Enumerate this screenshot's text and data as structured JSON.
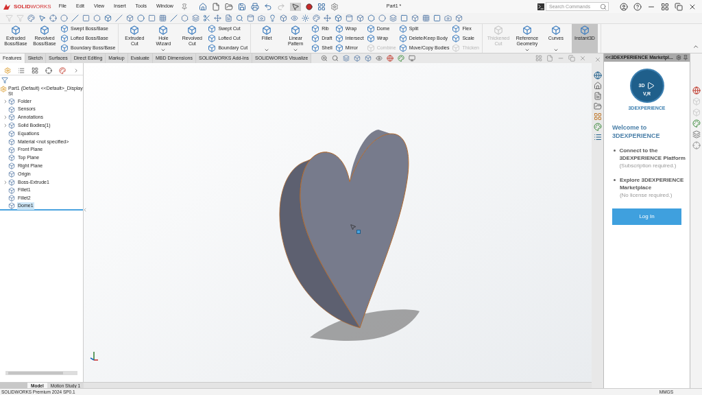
{
  "app": {
    "logo": "**SOLID**WORKS",
    "menu": [
      "File",
      "Edit",
      "View",
      "Insert",
      "Tools",
      "Window"
    ],
    "title": "Part1 *",
    "search": {
      "placeholder": "Search Commands"
    }
  },
  "ribbon": {
    "groups": [
      {
        "columns": [
          {
            "kind": "large",
            "label": "Extruded Boss/Base",
            "disabled": false,
            "dropdown": false
          },
          {
            "kind": "large",
            "label": "Revolved Boss/Base",
            "disabled": false,
            "dropdown": false
          },
          {
            "kind": "stack",
            "items": [
              {
                "label": "Swept Boss/Base",
                "disabled": false
              },
              {
                "label": "Lofted Boss/Base",
                "disabled": false
              },
              {
                "label": "Boundary Boss/Base",
                "disabled": false
              }
            ]
          }
        ]
      },
      {
        "columns": [
          {
            "kind": "large",
            "label": "Extruded Cut",
            "disabled": false,
            "dropdown": false
          },
          {
            "kind": "large",
            "label": "Hole Wizard",
            "disabled": false,
            "dropdown": true
          },
          {
            "kind": "large",
            "label": "Revolved Cut",
            "disabled": false,
            "dropdown": false
          },
          {
            "kind": "stack",
            "items": [
              {
                "label": "Swept Cut",
                "disabled": false
              },
              {
                "label": "Lofted Cut",
                "disabled": false
              },
              {
                "label": "Boundary Cut",
                "disabled": false
              }
            ]
          }
        ]
      },
      {
        "columns": [
          {
            "kind": "large",
            "label": "Fillet",
            "disabled": false,
            "dropdown": true
          },
          {
            "kind": "large",
            "label": "Linear Pattern",
            "disabled": false,
            "dropdown": true
          },
          {
            "kind": "stack",
            "items": [
              {
                "label": "Rib",
                "disabled": false
              },
              {
                "label": "Draft",
                "disabled": false
              },
              {
                "label": "Shell",
                "disabled": false
              }
            ]
          },
          {
            "kind": "stack",
            "items": [
              {
                "label": "Wrap",
                "disabled": false
              },
              {
                "label": "Intersect",
                "disabled": false
              },
              {
                "label": "Mirror",
                "disabled": false
              }
            ]
          },
          {
            "kind": "stack",
            "items": [
              {
                "label": "Dome",
                "disabled": false
              },
              {
                "label": "Wrap",
                "disabled": false
              },
              {
                "label": "Combine",
                "disabled": true
              }
            ]
          },
          {
            "kind": "stack",
            "items": [
              {
                "label": "Split",
                "disabled": false
              },
              {
                "label": "Delete/Keep Body",
                "disabled": false
              },
              {
                "label": "Move/Copy Bodies",
                "disabled": false
              }
            ]
          },
          {
            "kind": "stack",
            "items": [
              {
                "label": "Flex",
                "disabled": false
              },
              {
                "label": "Scale",
                "disabled": false
              },
              {
                "label": "Thicken",
                "disabled": true
              }
            ]
          }
        ]
      },
      {
        "columns": [
          {
            "kind": "large",
            "label": "Thickened Cut",
            "disabled": true,
            "dropdown": false
          },
          {
            "kind": "large",
            "label": "Reference Geometry",
            "disabled": false,
            "dropdown": true
          },
          {
            "kind": "large",
            "label": "Curves",
            "disabled": false,
            "dropdown": true
          },
          {
            "kind": "large",
            "label": "Instant3D",
            "disabled": false,
            "dropdown": false,
            "selected": true
          }
        ]
      }
    ]
  },
  "tabs": [
    {
      "label": "Features",
      "selected": true
    },
    {
      "label": "Sketch",
      "selected": false
    },
    {
      "label": "Surfaces",
      "selected": false
    },
    {
      "label": "Direct Editing",
      "selected": false
    },
    {
      "label": "Markup",
      "selected": false
    },
    {
      "label": "Evaluate",
      "selected": false
    },
    {
      "label": "MBD Dimensions",
      "selected": false
    },
    {
      "label": "SOLIDWORKS Add-Ins",
      "selected": false
    },
    {
      "label": "SOLIDWORKS Visualize",
      "selected": false
    }
  ],
  "tree": {
    "label": "Part1 (Default) <<Default>_Display St",
    "children": [
      {
        "label": "Folder",
        "expander": true,
        "selected": false
      },
      {
        "label": "Sensors",
        "expander": false,
        "selected": false
      },
      {
        "label": "Annotations",
        "expander": true,
        "selected": false
      },
      {
        "label": "Solid Bodies(1)",
        "expander": true,
        "selected": false
      },
      {
        "label": "Equations",
        "expander": false,
        "selected": false
      },
      {
        "label": "Material <not specified>",
        "expander": false,
        "selected": false
      },
      {
        "label": "Front Plane",
        "expander": false,
        "selected": false
      },
      {
        "label": "Top Plane",
        "expander": false,
        "selected": false
      },
      {
        "label": "Right Plane",
        "expander": false,
        "selected": false
      },
      {
        "label": "Origin",
        "expander": false,
        "selected": false
      },
      {
        "label": "Boss-Extrude1",
        "expander": true,
        "selected": false
      },
      {
        "label": "Fillet1",
        "expander": false,
        "selected": false
      },
      {
        "label": "Fillet2",
        "expander": false,
        "selected": false
      },
      {
        "label": "Dome1",
        "expander": false,
        "selected": true
      }
    ]
  },
  "bottom_tabs": [
    {
      "label": "Model",
      "selected": true
    },
    {
      "label": "Motion Study 1",
      "selected": false
    }
  ],
  "task_pane": {
    "title": "<<3DEXPERIENCE Marketpl...",
    "logo_marks": [
      "3D",
      "V,R"
    ],
    "brand": "3DEXPERIENCE",
    "heading": "Welcome to 3DEXPERIENCE",
    "bullets": [
      {
        "title": "Connect to the 3DEXPERIENCE Platform",
        "note": "(Subscription required.)"
      },
      {
        "title": "Explore 3DEXPERIENCE Marketplace",
        "note": "(No license required.)"
      }
    ],
    "button": "Log In"
  },
  "status_bar": {
    "version": "SOLIDWORKS Premium 2024 SP0.1",
    "units": "MMGS"
  }
}
